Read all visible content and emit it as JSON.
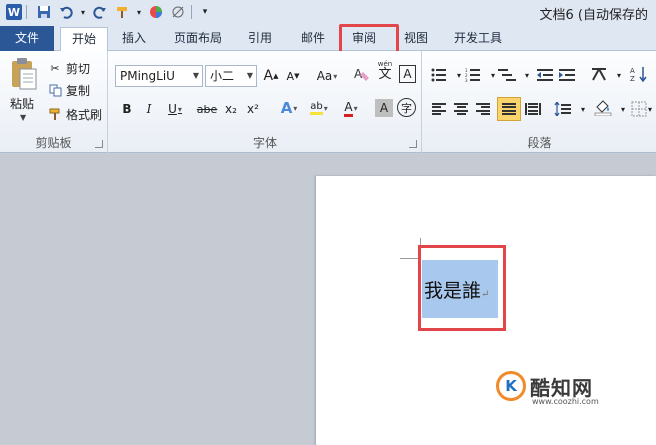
{
  "titlebar": {
    "app_icon": "W",
    "doc_title": "文档6 (自动保存的"
  },
  "tabs": {
    "file": "文件",
    "home": "开始",
    "insert": "插入",
    "layout": "页面布局",
    "references": "引用",
    "mailings": "邮件",
    "review": "审阅",
    "view": "视图",
    "developer": "开发工具"
  },
  "clipboard": {
    "paste": "粘贴",
    "cut": "剪切",
    "copy": "复制",
    "format_painter": "格式刷",
    "group_label": "剪贴板"
  },
  "font": {
    "font_name": "PMingLiU",
    "font_size": "小二",
    "grow": "A",
    "shrink": "A",
    "change_case": "Aa",
    "clear": "A",
    "phonetic": "wén",
    "phonetic_char": "文",
    "border_char": "A",
    "bold": "B",
    "italic": "I",
    "underline": "U",
    "strike": "abe",
    "subscript": "x₂",
    "superscript": "x²",
    "effects": "A",
    "highlight": "ab",
    "font_color": "A",
    "char_shading": "A",
    "enclose": "字",
    "group_label": "字体"
  },
  "paragraph": {
    "group_label": "段落"
  },
  "document": {
    "text": "我是誰",
    "para_mark": "↵"
  },
  "watermark": {
    "logo": "K",
    "name": "酷知网",
    "url": "www.coozhi.com"
  },
  "colors": {
    "highlight_box": "#e2454a",
    "selection": "#a9c8ee",
    "file_tab": "#2b5797"
  }
}
